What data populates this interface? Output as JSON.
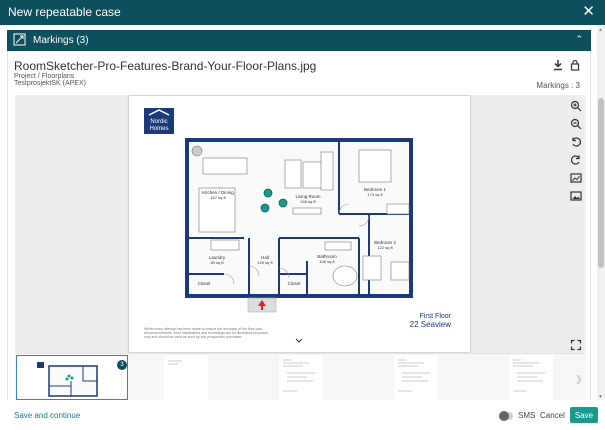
{
  "dialog": {
    "title": "New repeatable case"
  },
  "markings_section": {
    "label": "Markings (3)"
  },
  "document": {
    "file_name": "RoomSketcher-Pro-Features-Brand-Your-Floor-Plans.jpg",
    "project_path": "Project / Floorplans",
    "project_name": "TestprosjektSK (APEX)",
    "markings_count": "Markings : 3"
  },
  "floorplan": {
    "brand_line1": "Nordic",
    "brand_line2": "Homes",
    "rooms": [
      {
        "name": "Kitchen / Dining",
        "area": "167 sq ft"
      },
      {
        "name": "Living Room",
        "area": "240 sq ft"
      },
      {
        "name": "Bedroom 1",
        "area": "174 sq ft"
      },
      {
        "name": "Bedroom 2",
        "area": "122 sq ft"
      },
      {
        "name": "Laundry",
        "area": "80 sq ft"
      },
      {
        "name": "Hall",
        "area": "149 sq ft"
      },
      {
        "name": "Bathroom",
        "area": "106 sq ft"
      },
      {
        "name": "Closet",
        "area": ""
      },
      {
        "name": "Closet",
        "area": ""
      }
    ],
    "floor_label": "First Floor",
    "address": "22 Seaview",
    "disclaimer_lines": [
      "Whilst every attempt has been made to ensure the accuracy of the floor plan,",
      "all measurements, fixed installations and furnishings are for illustrative purposes",
      "only and should be used as such by any prospective purchaser."
    ]
  },
  "thumbnails": {
    "active_badge": "3"
  },
  "footer": {
    "save_continue_label": "Save and continue",
    "sms_label": "SMS",
    "cancel_label": "Cancel",
    "save_label": "Save"
  },
  "colors": {
    "header": "#0d4f5c",
    "accent": "#1a9a8f",
    "marker": "#1a9a8f",
    "wall": "#1a3a7a"
  }
}
